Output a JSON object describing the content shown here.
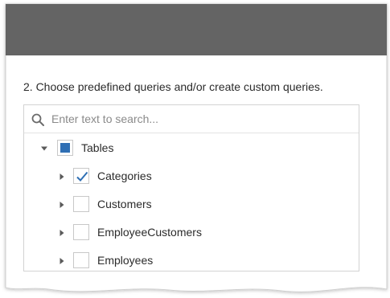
{
  "wizard": {
    "step_title": "2. Choose predefined queries and/or create custom queries."
  },
  "search": {
    "placeholder": "Enter text to search...",
    "value": ""
  },
  "tree": {
    "root": {
      "label": "Tables",
      "expanded": true,
      "check_state": "indeterminate"
    },
    "children": [
      {
        "label": "Categories",
        "expanded": false,
        "checked": true
      },
      {
        "label": "Customers",
        "expanded": false,
        "checked": false
      },
      {
        "label": "EmployeeCustomers",
        "expanded": false,
        "checked": false
      },
      {
        "label": "Employees",
        "expanded": false,
        "checked": false
      }
    ]
  },
  "colors": {
    "header_band": "#646464",
    "accent": "#2f6fb4",
    "text": "#2b2b2b",
    "border": "#d3d3d3"
  },
  "icons": {
    "search": "search-icon",
    "expanded": "triangle-down-icon",
    "collapsed": "triangle-right-icon",
    "check": "checkmark-icon"
  }
}
